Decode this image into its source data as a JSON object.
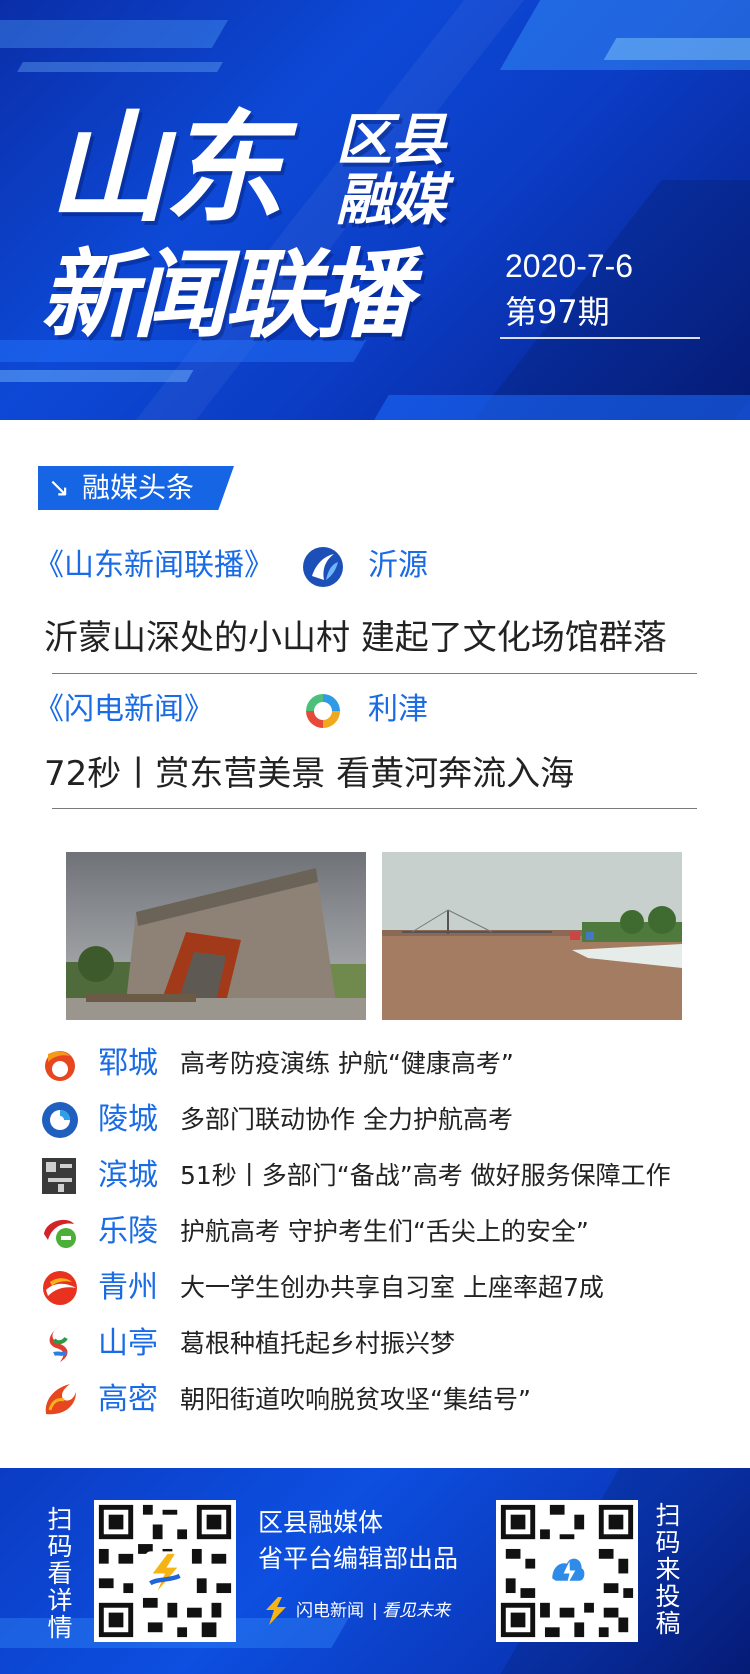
{
  "header": {
    "title_main": "山东",
    "title_sub1": "区县",
    "title_sub2": "融媒",
    "title_line2": "新闻联播",
    "date": "2020-7-6",
    "issue": "第97期"
  },
  "section": {
    "label": "融媒头条",
    "icon": "arrow-down-right-icon"
  },
  "headlines": [
    {
      "program": "《山东新闻联播》",
      "place": "沂源",
      "title": "沂蒙山深处的小山村 建起了文化场馆群落"
    },
    {
      "program": "《闪电新闻》",
      "place": "利津",
      "title": "72秒丨赏东营美景  看黄河奔流入海"
    }
  ],
  "counties": [
    {
      "name": "郓城",
      "news": "高考防疫演练 护航“健康高考”"
    },
    {
      "name": "陵城",
      "news": "多部门联动协作 全力护航高考"
    },
    {
      "name": "滨城",
      "news": "51秒丨多部门“备战”高考 做好服务保障工作"
    },
    {
      "name": "乐陵",
      "news": "护航高考 守护考生们“舌尖上的安全”"
    },
    {
      "name": "青州",
      "news": "大一学生创办共享自习室 上座率超7成"
    },
    {
      "name": "山亭",
      "news": "葛根种植托起乡村振兴梦"
    },
    {
      "name": "高密",
      "news": "朝阳街道吹响脱贫攻坚“集结号”"
    }
  ],
  "footer": {
    "left_vertical": "扫码看详情",
    "right_vertical": "扫码来投稿",
    "line1": "区县融媒体",
    "line2": "省平台编辑部出品",
    "brand": "闪电新闻",
    "slogan": "看见未来"
  },
  "colors": {
    "accent": "#1a6be6",
    "header_blue": "#0d49d6",
    "tag_blue": "#1565e4",
    "text": "#222222"
  }
}
